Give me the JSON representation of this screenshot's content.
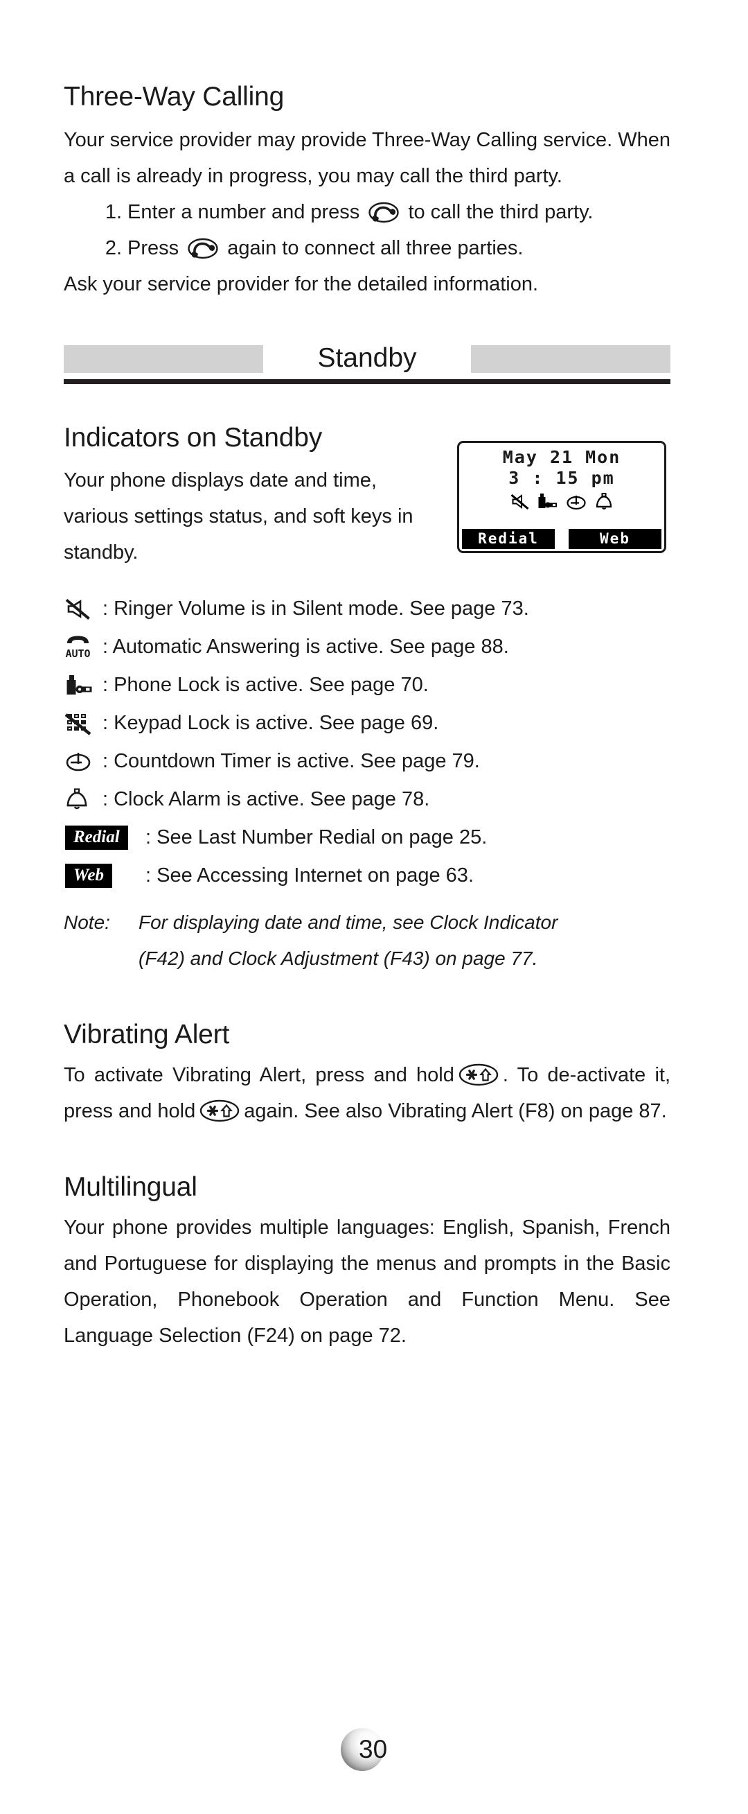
{
  "doc": {
    "page_number": "30"
  },
  "three_way": {
    "title": "Three-Way Calling",
    "intro": "Your service provider may provide Three-Way Calling service. When a call is already in progress, you may call the third party.",
    "steps": [
      {
        "num": "1.",
        "before": "Enter a number and press",
        "icon": "send-key-icon",
        "after": "to call the third party."
      },
      {
        "num": "2.",
        "before": "Press",
        "icon": "send-key-icon",
        "after": "again to connect all three parties."
      }
    ],
    "closing": "Ask your service provider for the detailed information."
  },
  "chapter_banner": {
    "title": "Standby",
    "bar_color": "#d2d2d2",
    "rule_color": "#231f20"
  },
  "indicators": {
    "title": "Indicators on Standby",
    "intro": "Your phone displays date and time, various settings status, and soft keys in standby.",
    "screen": {
      "date_line": "May 21 Mon",
      "time_line": "3 : 15 pm",
      "status_icons": [
        "silent-ringer-icon",
        "phone-lock-icon",
        "countdown-timer-icon",
        "clock-alarm-icon"
      ],
      "softkey_left": "Redial",
      "softkey_right": "Web"
    },
    "legend": [
      {
        "icon": "silent-ringer-icon",
        "text": ": Ringer Volume  is in Silent  mode. See page 73."
      },
      {
        "icon": "auto-answer-icon",
        "text": ": Automatic Answering   is active. See page 88."
      },
      {
        "icon": "phone-lock-icon",
        "text": ": Phone Lock  is active. See page 70."
      },
      {
        "icon": "keypad-lock-icon",
        "text": ": Keypad Lock  is active. See page 69."
      },
      {
        "icon": "countdown-timer-icon",
        "text": ": Countdown  Timer is active. See page 79."
      },
      {
        "icon": "clock-alarm-icon",
        "text": ": Clock Alarm  is active. See page 78."
      }
    ],
    "tag_legend": [
      {
        "tag": "Redial",
        "text": ": See Last Number Redial   on page 25."
      },
      {
        "tag": "Web",
        "text": ": See Accessing Internet    on page 63."
      }
    ],
    "note_label": "Note:",
    "note_line1": "For displaying date and time, see Clock Indicator",
    "note_line2": "(F42) and Clock Adjustment (F43)   on page 77."
  },
  "vibrating": {
    "title": "Vibrating Alert",
    "text_1": "To activate Vibrating Alert, press and hold",
    "icon_1": "star-shift-key-icon",
    "text_2": ". To de-activate it, press and hold",
    "icon_2": "star-shift-key-icon",
    "text_3": "again. See also Vibrating Alert (F8)  on page 87."
  },
  "multilingual": {
    "title": "Multilingual",
    "body": "Your phone provides multiple languages: English, Spanish, French and Portuguese for displaying the menus and prompts in the Basic Operation, Phonebook Operation and Function Menu. See Language Selection (F24) on page 72."
  }
}
